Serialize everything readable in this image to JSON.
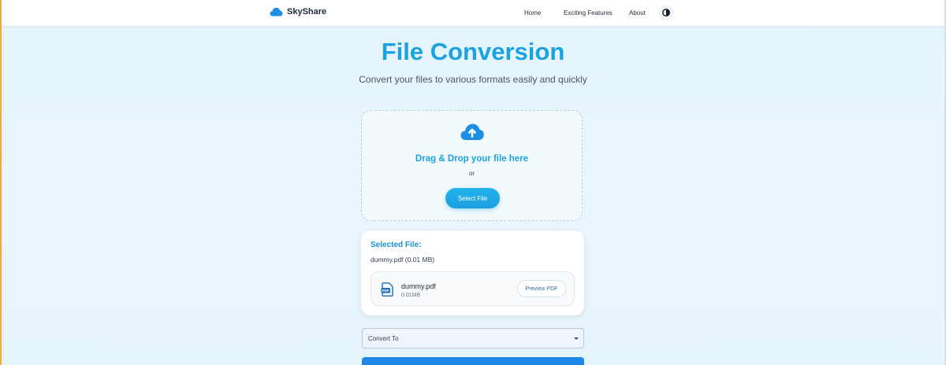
{
  "brand": {
    "name": "SkyShare",
    "logo_icon": "cloud-icon",
    "color": "#1a8fe3"
  },
  "nav": {
    "links": [
      {
        "label": "Home"
      },
      {
        "label": "Exciting Features"
      },
      {
        "label": "About"
      }
    ],
    "theme_toggle_icon": "contrast-icon"
  },
  "hero": {
    "title": "File Conversion",
    "subtitle": "Convert your files to various formats easily and quickly"
  },
  "dropzone": {
    "icon": "cloud-upload-icon",
    "heading": "Drag & Drop your file here",
    "or_text": "or",
    "button_label": "Select File"
  },
  "selected": {
    "label": "Selected File:",
    "summary": "dummy.pdf (0.01 MB)",
    "file": {
      "icon": "pdf-file-icon",
      "name": "dummy.pdf",
      "size": "0.01MB",
      "preview_label": "Preview PDF"
    }
  },
  "convert": {
    "select_value": "Convert To"
  },
  "colors": {
    "accent": "#1aa3e0",
    "primary_button": "#1e88e5",
    "window_edge": "#f0a94a"
  }
}
